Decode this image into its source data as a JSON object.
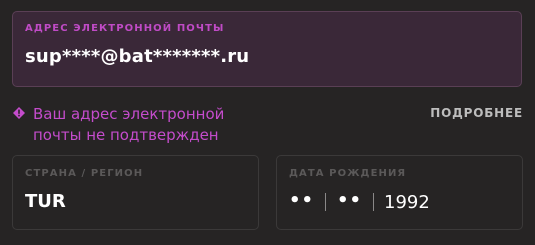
{
  "email": {
    "label": "АДРЕС ЭЛЕКТРОННОЙ ПОЧТЫ",
    "value": "sup****@bat*******.ru"
  },
  "warning": {
    "icon": "warning-diamond-icon",
    "text": "Ваш адрес электронной почты не подтвержден",
    "color": "#c44ccc"
  },
  "details_link": "ПОДРОБНЕЕ",
  "country": {
    "label": "СТРАНА / РЕГИОН",
    "value": "TUR"
  },
  "birth_date": {
    "label": "ДАТА РОЖДЕНИЯ",
    "day": "••",
    "month": "••",
    "year": "1992"
  },
  "colors": {
    "accent": "#c04bc6",
    "background": "#262424",
    "email_field_bg": "#3a2838"
  }
}
